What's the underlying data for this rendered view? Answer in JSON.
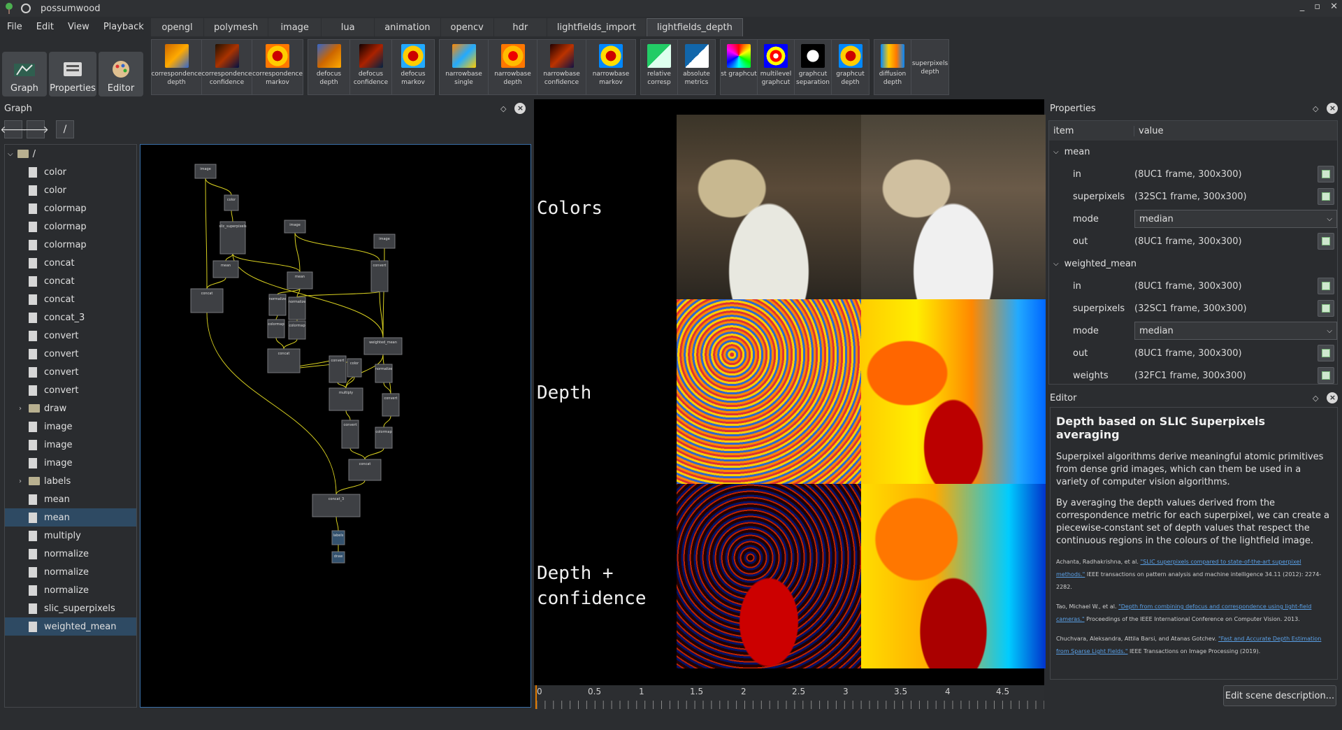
{
  "window": {
    "title": "possumwood",
    "controls": [
      "_",
      "▫",
      "✕"
    ]
  },
  "menu": [
    "File",
    "Edit",
    "View",
    "Playback"
  ],
  "tabs": [
    "opengl",
    "polymesh",
    "image",
    "lua",
    "animation",
    "opencv",
    "hdr",
    "lightfields_import",
    "lightfields_depth"
  ],
  "active_tab": "lightfields_depth",
  "modes": [
    {
      "label": "Graph",
      "icon": "graph-icon"
    },
    {
      "label": "Properties",
      "icon": "properties-icon"
    },
    {
      "label": "Editor",
      "icon": "editor-icon"
    }
  ],
  "toolbar": {
    "groups": [
      [
        {
          "label": "correspondence depth",
          "icon": "correspondence-depth-icon"
        },
        {
          "label": "correspondence confidence",
          "icon": "correspondence-confidence-icon"
        },
        {
          "label": "correspondence markov",
          "icon": "correspondence-markov-icon"
        }
      ],
      [
        {
          "label": "defocus depth",
          "icon": "defocus-depth-icon"
        },
        {
          "label": "defocus confidence",
          "icon": "defocus-confidence-icon"
        },
        {
          "label": "defocus markov",
          "icon": "defocus-markov-icon"
        }
      ],
      [
        {
          "label": "narrowbase single",
          "icon": "narrowbase-single-icon"
        },
        {
          "label": "narrowbase depth",
          "icon": "narrowbase-depth-icon"
        },
        {
          "label": "narrowbase confidence",
          "icon": "narrowbase-confidence-icon"
        },
        {
          "label": "narrowbase markov",
          "icon": "narrowbase-markov-icon"
        }
      ],
      [
        {
          "label": "relative corresp",
          "icon": "relative-corresp-icon"
        },
        {
          "label": "absolute metrics",
          "icon": "absolute-metrics-icon"
        }
      ],
      [
        {
          "label": "st graphcut",
          "icon": "st-graphcut-icon"
        },
        {
          "label": "multilevel graphcut",
          "icon": "multilevel-graphcut-icon"
        },
        {
          "label": "graphcut separation",
          "icon": "graphcut-separation-icon"
        },
        {
          "label": "graphcut depth",
          "icon": "graphcut-depth-icon"
        }
      ],
      [
        {
          "label": "diffusion depth",
          "icon": "diffusion-depth-icon"
        },
        {
          "label": "superpixels depth",
          "icon": ""
        }
      ]
    ]
  },
  "graph_panel": {
    "title": "Graph",
    "path": "/",
    "root": "/",
    "items": [
      {
        "label": "color",
        "type": "node"
      },
      {
        "label": "color",
        "type": "node"
      },
      {
        "label": "colormap",
        "type": "node"
      },
      {
        "label": "colormap",
        "type": "node"
      },
      {
        "label": "colormap",
        "type": "node"
      },
      {
        "label": "concat",
        "type": "node"
      },
      {
        "label": "concat",
        "type": "node"
      },
      {
        "label": "concat",
        "type": "node"
      },
      {
        "label": "concat_3",
        "type": "node"
      },
      {
        "label": "convert",
        "type": "node"
      },
      {
        "label": "convert",
        "type": "node"
      },
      {
        "label": "convert",
        "type": "node"
      },
      {
        "label": "convert",
        "type": "node"
      },
      {
        "label": "draw",
        "type": "folder"
      },
      {
        "label": "image",
        "type": "node"
      },
      {
        "label": "image",
        "type": "node"
      },
      {
        "label": "image",
        "type": "node"
      },
      {
        "label": "labels",
        "type": "folder"
      },
      {
        "label": "mean",
        "type": "node"
      },
      {
        "label": "mean",
        "type": "node",
        "selected": true
      },
      {
        "label": "multiply",
        "type": "node"
      },
      {
        "label": "normalize",
        "type": "node"
      },
      {
        "label": "normalize",
        "type": "node"
      },
      {
        "label": "normalize",
        "type": "node"
      },
      {
        "label": "slic_superpixels",
        "type": "node"
      },
      {
        "label": "weighted_mean",
        "type": "node",
        "selected": true
      }
    ],
    "nodes": [
      "image",
      "color",
      "slic_superpixels",
      "image",
      "image",
      "mean",
      "convert",
      "concat",
      "mean",
      "normalize",
      "normalize",
      "colormap",
      "colormap",
      "weighted_mean",
      "concat",
      "convert",
      "color",
      "normalize",
      "multiply",
      "convert",
      "convert",
      "colormap",
      "concat",
      "concat_3",
      "labels",
      "draw"
    ]
  },
  "viewport": {
    "rows": [
      "Colors",
      "Depth",
      "Depth +\nconfidence"
    ],
    "timeline": [
      "0",
      "0.5",
      "1",
      "1.5",
      "2",
      "2.5",
      "3",
      "3.5",
      "4",
      "4.5"
    ]
  },
  "properties": {
    "title": "Properties",
    "headers": [
      "item",
      "value"
    ],
    "groups": [
      {
        "name": "mean",
        "rows": [
          {
            "item": "in",
            "value": "(8UC1 frame, 300x300)",
            "button": true
          },
          {
            "item": "superpixels",
            "value": "(32SC1 frame, 300x300)",
            "button": true
          },
          {
            "item": "mode",
            "value": "median",
            "combo": true
          },
          {
            "item": "out",
            "value": "(8UC1 frame, 300x300)",
            "button": true
          }
        ]
      },
      {
        "name": "weighted_mean",
        "rows": [
          {
            "item": "in",
            "value": "(8UC1 frame, 300x300)",
            "button": true
          },
          {
            "item": "superpixels",
            "value": "(32SC1 frame, 300x300)",
            "button": true
          },
          {
            "item": "mode",
            "value": "median",
            "combo": true
          },
          {
            "item": "out",
            "value": "(8UC1 frame, 300x300)",
            "button": true
          },
          {
            "item": "weights",
            "value": "(32FC1 frame, 300x300)",
            "button": true
          }
        ]
      }
    ]
  },
  "editor": {
    "title": "Editor",
    "heading": "Depth based on SLIC Superpixels averaging",
    "paragraphs": [
      "Superpixel algorithms derive meaningful atomic primitives from dense grid images, which can them be used in a variety of computer vision algorithms.",
      "By averaging the depth values derived from the correspondence metric for each superpixel, we can create a piecewise-constant set of depth values that respect the continuous regions in the colours of the lightfield image."
    ],
    "refs": [
      {
        "pre": "Achanta, Radhakrishna, et al. ",
        "link": "\"SLIC superpixels compared to state-of-the-art superpixel methods.\"",
        "post": " IEEE transactions on pattern analysis and machine intelligence 34.11 (2012): 2274-2282."
      },
      {
        "pre": "Tao, Michael W., et al. ",
        "link": "\"Depth from combining defocus and correspondence using light-field cameras.\"",
        "post": " Proceedings of the IEEE International Conference on Computer Vision. 2013."
      },
      {
        "pre": "Chuchvara, Aleksandra, Attila Barsi, and Atanas Gotchev. ",
        "link": "\"Fast and Accurate Depth Estimation from Sparse Light Fields.\"",
        "post": " IEEE Transactions on Image Processing (2019)."
      }
    ],
    "button": "Edit scene description..."
  }
}
